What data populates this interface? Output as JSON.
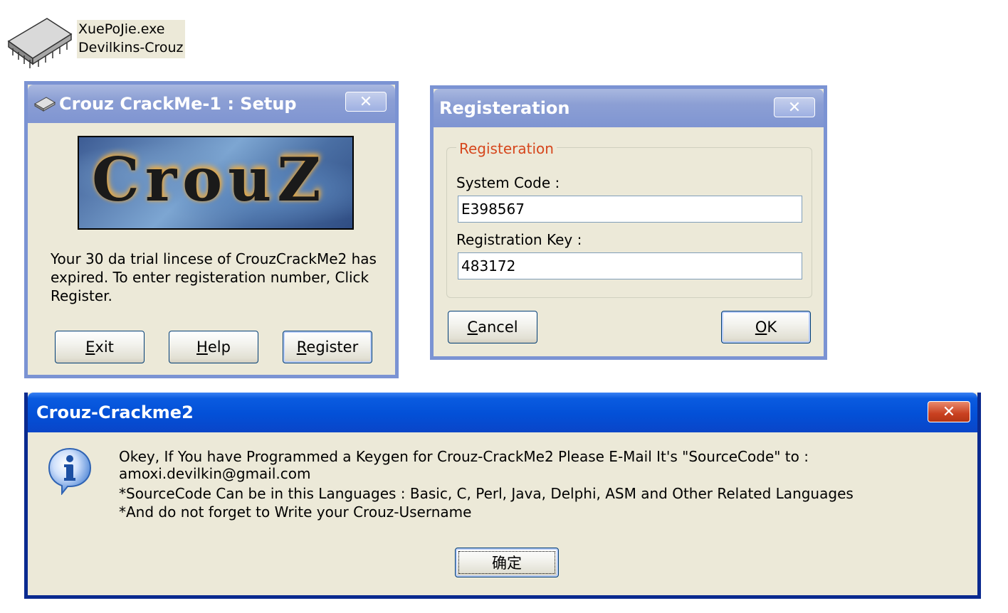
{
  "desktop_file": {
    "name": "XuePoJie.exe",
    "description": "Devilkins-Crouz",
    "icon": "chip-icon"
  },
  "setup_window": {
    "title": "Crouz CrackMe-1 : Setup",
    "title_icon": "chip-icon",
    "banner_text": "CrouZ",
    "message": "Your 30 da trial lincese of CrouzCrackMe2 has expired. To enter registeration number, Click Register.",
    "buttons": {
      "exit": "Exit",
      "help": "Help",
      "register": "Register"
    },
    "close_symbol": "✕"
  },
  "registration_window": {
    "title": "Registeration",
    "group_label": "Registeration",
    "system_code_label": "System Code :",
    "system_code_value": "E398567",
    "registration_key_label": "Registration Key :",
    "registration_key_value": "483172",
    "buttons": {
      "cancel": "Cancel",
      "ok": "OK"
    },
    "close_symbol": "✕"
  },
  "message_box": {
    "title": "Crouz-Crackme2",
    "icon": "info-icon",
    "line1": "Okey, If You have Programmed a Keygen for Crouz-CrackMe2 Please E-Mail It's \"SourceCode\" to : amoxi.devilkin@gmail.com",
    "line2": "*SourceCode Can be in this Languages : Basic, C, Perl, Java, Delphi, ASM and Other Related Languages",
    "line3": "*And do not forget to Write your Crouz-Username",
    "ok_button": "确定",
    "close_symbol": "✕"
  },
  "colors": {
    "window_face": "#ece9d8",
    "inactive_title": "#8c9fd4",
    "active_title": "#0a5be0",
    "group_label": "#d6461c",
    "close_red": "#c94121"
  }
}
